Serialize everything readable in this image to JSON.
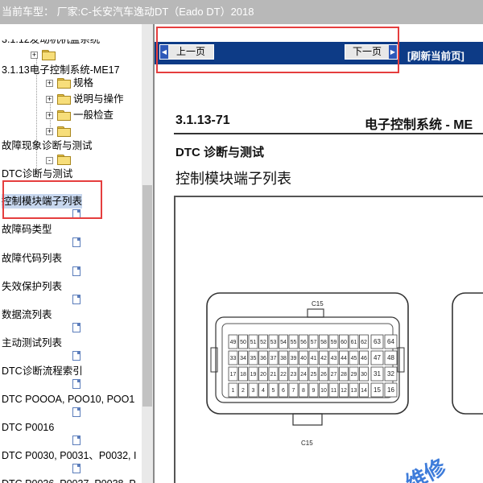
{
  "title_bar": {
    "text": "当前车型：  厂家:C-长安汽车逸动DT（Eado DT）2018"
  },
  "tree": {
    "items": [
      {
        "label": "3.1.12发动机机盖系统"
      },
      {
        "label": "3.1.13电子控制系统-ME17"
      },
      {
        "label": "规格"
      },
      {
        "label": "说明与操作"
      },
      {
        "label": "一般检查"
      },
      {
        "label": "故障现象诊断与测试"
      },
      {
        "label": "DTC诊断与测试"
      },
      {
        "label": "控制模块端子列表",
        "selected": true
      },
      {
        "label": "故障码类型"
      },
      {
        "label": "故障代码列表"
      },
      {
        "label": "失效保护列表"
      },
      {
        "label": "数据流列表"
      },
      {
        "label": "主动测试列表"
      },
      {
        "label": "DTC诊断流程索引"
      },
      {
        "label": "DTC POOOA, POO10, POO1"
      },
      {
        "label": "DTC P0016"
      },
      {
        "label": "DTC P0030, P0031、P0032, I"
      },
      {
        "label": "DTC P0036, P0037, P0038, P"
      }
    ]
  },
  "nav": {
    "prev_label": "上一页",
    "next_label": "下一页",
    "refresh_label": "[刷新当前页]"
  },
  "document": {
    "page_number": "3.1.13-71",
    "section_title": "电子控制系统 - ME",
    "heading": "DTC 诊断与测试",
    "subheading": "控制模块端子列表",
    "connector_top_label": "C15",
    "connector_bottom_label": "C15",
    "pin_rows": [
      [
        "49",
        "50",
        "51",
        "52",
        "53",
        "54",
        "55",
        "56",
        "57",
        "58",
        "59",
        "60",
        "61",
        "62",
        "63",
        "64"
      ],
      [
        "33",
        "34",
        "35",
        "36",
        "37",
        "38",
        "39",
        "40",
        "41",
        "42",
        "43",
        "44",
        "45",
        "46",
        "47",
        "48"
      ],
      [
        "17",
        "18",
        "19",
        "20",
        "21",
        "22",
        "23",
        "24",
        "25",
        "26",
        "27",
        "28",
        "29",
        "30",
        "31",
        "32"
      ],
      [
        "1",
        "2",
        "3",
        "4",
        "5",
        "6",
        "7",
        "8",
        "9",
        "10",
        "11",
        "12",
        "13",
        "14",
        "15",
        "16"
      ]
    ]
  },
  "watermark": {
    "text": "维修"
  },
  "colors": {
    "title_bar": "#b8b8b8",
    "nav_bar": "#0d3b86",
    "highlight_box": "#e53e3e",
    "selection": "#c7d7ee"
  }
}
